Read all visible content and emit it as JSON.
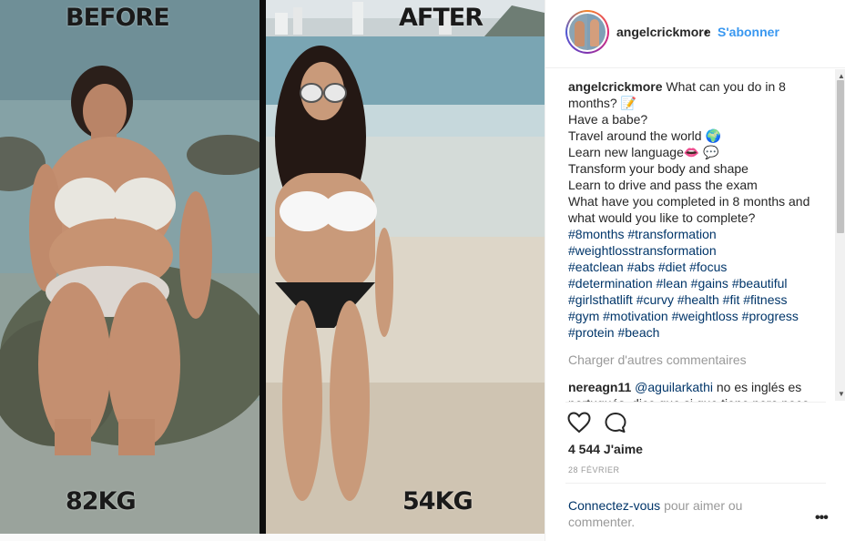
{
  "photo": {
    "label_before": "BEFORE",
    "label_after": "AFTER",
    "weight_before": "82KG",
    "weight_after": "54KG"
  },
  "post": {
    "username": "angelcrickmore",
    "separator": "•",
    "follow_label": "S'abonner",
    "caption_user": "angelcrickmore",
    "caption_lines": [
      "What can you do in 8 months? 📝",
      "Have a babe?",
      "Travel around the world 🌍",
      "Learn new language👄 💬",
      "Transform your body and shape",
      "Learn to drive and pass the exam",
      "What have you completed in 8 months and what would you like to complete?"
    ],
    "hashtags": [
      [
        "#8months",
        "#transformation"
      ],
      [
        "#weightlosstransformation"
      ],
      [
        "#eatclean",
        "#abs",
        "#diet",
        "#focus"
      ],
      [
        "#determination",
        "#lean",
        "#gains",
        "#beautiful"
      ],
      [
        "#girlsthatlift",
        "#curvy",
        "#health",
        "#fit",
        "#fitness"
      ],
      [
        "#gym",
        "#motivation",
        "#weightloss",
        "#progress"
      ],
      [
        "#protein",
        "#beach"
      ]
    ],
    "load_more": "Charger d'autres commentaires",
    "comment": {
      "user": "nereagn11",
      "mention": "@aguilarkathi",
      "text": "no es inglés es portugués, dice que si que tiene pero poco"
    },
    "likes": "4 544 J'aime",
    "date": "28 FÉVRIER",
    "login_link": "Connectez-vous",
    "login_text": "pour aimer ou commenter.",
    "more_label": "•••"
  },
  "icons": {
    "like": "heart-icon",
    "comment": "comment-bubble-icon",
    "scroll_up": "triangle-up",
    "scroll_down": "triangle-down"
  },
  "colors": {
    "link_blue": "#3897f0",
    "hashtag": "#003569",
    "muted": "#999999"
  }
}
